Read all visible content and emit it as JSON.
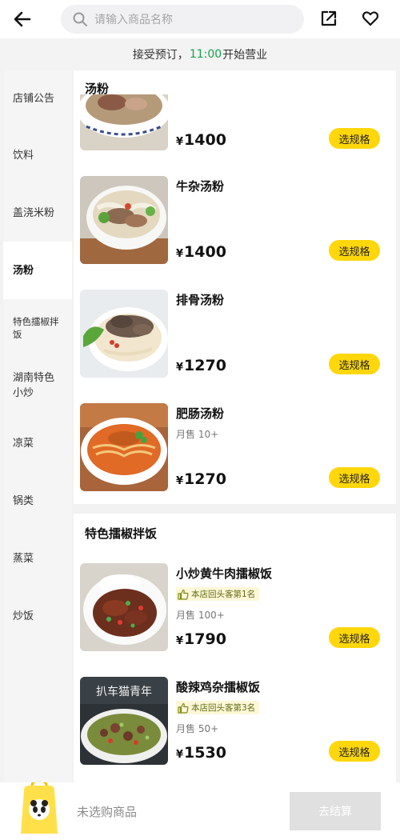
{
  "header": {
    "search_placeholder": "请输入商品名称",
    "icons": {
      "back": "back-arrow-icon",
      "search": "search-icon",
      "share": "share-icon",
      "favorite": "heart-icon"
    }
  },
  "notice": {
    "prefix": "接受预订，",
    "time": "11:00",
    "suffix": "开始营业",
    "time_color": "#16a34a"
  },
  "categories": [
    {
      "label": "店铺公告"
    },
    {
      "label": "饮料"
    },
    {
      "label": "盖浇米粉"
    },
    {
      "label": "汤粉",
      "active": true
    },
    {
      "label": "特色擂椒拌饭"
    },
    {
      "label": "湖南特色小炒"
    },
    {
      "label": "凉菜"
    },
    {
      "label": "锅类"
    },
    {
      "label": "蒸菜"
    },
    {
      "label": "炒饭"
    }
  ],
  "sections": [
    {
      "title": "汤粉",
      "items": [
        {
          "name": "",
          "price": "1400",
          "button": "选规格"
        },
        {
          "name": "牛杂汤粉",
          "price": "1400",
          "button": "选规格"
        },
        {
          "name": "排骨汤粉",
          "price": "1270",
          "button": "选规格"
        },
        {
          "name": "肥肠汤粉",
          "sales": "月售 10+",
          "price": "1270",
          "button": "选规格"
        }
      ]
    },
    {
      "title": "特色擂椒拌饭",
      "items": [
        {
          "name": "小炒黄牛肉擂椒饭",
          "badge": "本店回头客第1名",
          "sales": "月售 100+",
          "price": "1790",
          "button": "选规格"
        },
        {
          "name": "酸辣鸡杂擂椒饭",
          "badge": "本店回头客第3名",
          "sales": "月售 50+",
          "price": "1530",
          "button": "选规格",
          "image_text": "扒车猫青年"
        }
      ]
    }
  ],
  "currency": "¥",
  "cart": {
    "empty_text": "未选购商品",
    "checkout_label": "去结算"
  },
  "colors": {
    "accent": "#ffd70a",
    "badge_bg": "#fdf7d7",
    "checkout_disabled": "#e0e0e0"
  }
}
